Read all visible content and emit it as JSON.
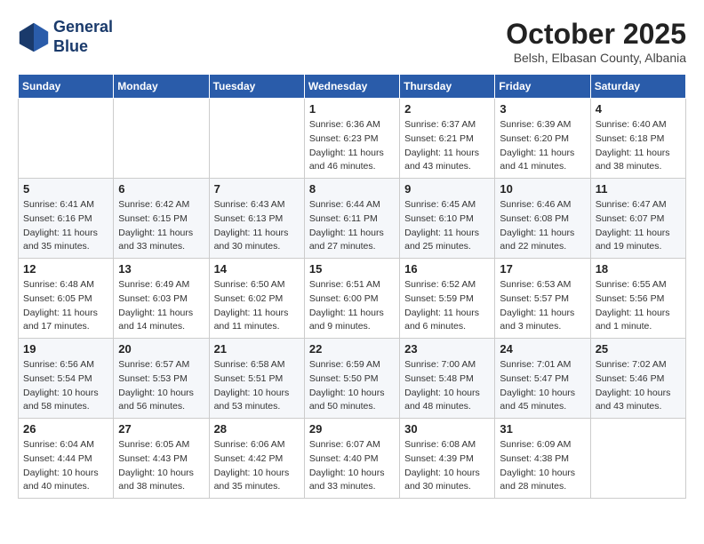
{
  "header": {
    "logo_line1": "General",
    "logo_line2": "Blue",
    "month": "October 2025",
    "location": "Belsh, Elbasan County, Albania"
  },
  "weekdays": [
    "Sunday",
    "Monday",
    "Tuesday",
    "Wednesday",
    "Thursday",
    "Friday",
    "Saturday"
  ],
  "weeks": [
    [
      {
        "day": "",
        "info": ""
      },
      {
        "day": "",
        "info": ""
      },
      {
        "day": "",
        "info": ""
      },
      {
        "day": "1",
        "info": "Sunrise: 6:36 AM\nSunset: 6:23 PM\nDaylight: 11 hours and 46 minutes."
      },
      {
        "day": "2",
        "info": "Sunrise: 6:37 AM\nSunset: 6:21 PM\nDaylight: 11 hours and 43 minutes."
      },
      {
        "day": "3",
        "info": "Sunrise: 6:39 AM\nSunset: 6:20 PM\nDaylight: 11 hours and 41 minutes."
      },
      {
        "day": "4",
        "info": "Sunrise: 6:40 AM\nSunset: 6:18 PM\nDaylight: 11 hours and 38 minutes."
      }
    ],
    [
      {
        "day": "5",
        "info": "Sunrise: 6:41 AM\nSunset: 6:16 PM\nDaylight: 11 hours and 35 minutes."
      },
      {
        "day": "6",
        "info": "Sunrise: 6:42 AM\nSunset: 6:15 PM\nDaylight: 11 hours and 33 minutes."
      },
      {
        "day": "7",
        "info": "Sunrise: 6:43 AM\nSunset: 6:13 PM\nDaylight: 11 hours and 30 minutes."
      },
      {
        "day": "8",
        "info": "Sunrise: 6:44 AM\nSunset: 6:11 PM\nDaylight: 11 hours and 27 minutes."
      },
      {
        "day": "9",
        "info": "Sunrise: 6:45 AM\nSunset: 6:10 PM\nDaylight: 11 hours and 25 minutes."
      },
      {
        "day": "10",
        "info": "Sunrise: 6:46 AM\nSunset: 6:08 PM\nDaylight: 11 hours and 22 minutes."
      },
      {
        "day": "11",
        "info": "Sunrise: 6:47 AM\nSunset: 6:07 PM\nDaylight: 11 hours and 19 minutes."
      }
    ],
    [
      {
        "day": "12",
        "info": "Sunrise: 6:48 AM\nSunset: 6:05 PM\nDaylight: 11 hours and 17 minutes."
      },
      {
        "day": "13",
        "info": "Sunrise: 6:49 AM\nSunset: 6:03 PM\nDaylight: 11 hours and 14 minutes."
      },
      {
        "day": "14",
        "info": "Sunrise: 6:50 AM\nSunset: 6:02 PM\nDaylight: 11 hours and 11 minutes."
      },
      {
        "day": "15",
        "info": "Sunrise: 6:51 AM\nSunset: 6:00 PM\nDaylight: 11 hours and 9 minutes."
      },
      {
        "day": "16",
        "info": "Sunrise: 6:52 AM\nSunset: 5:59 PM\nDaylight: 11 hours and 6 minutes."
      },
      {
        "day": "17",
        "info": "Sunrise: 6:53 AM\nSunset: 5:57 PM\nDaylight: 11 hours and 3 minutes."
      },
      {
        "day": "18",
        "info": "Sunrise: 6:55 AM\nSunset: 5:56 PM\nDaylight: 11 hours and 1 minute."
      }
    ],
    [
      {
        "day": "19",
        "info": "Sunrise: 6:56 AM\nSunset: 5:54 PM\nDaylight: 10 hours and 58 minutes."
      },
      {
        "day": "20",
        "info": "Sunrise: 6:57 AM\nSunset: 5:53 PM\nDaylight: 10 hours and 56 minutes."
      },
      {
        "day": "21",
        "info": "Sunrise: 6:58 AM\nSunset: 5:51 PM\nDaylight: 10 hours and 53 minutes."
      },
      {
        "day": "22",
        "info": "Sunrise: 6:59 AM\nSunset: 5:50 PM\nDaylight: 10 hours and 50 minutes."
      },
      {
        "day": "23",
        "info": "Sunrise: 7:00 AM\nSunset: 5:48 PM\nDaylight: 10 hours and 48 minutes."
      },
      {
        "day": "24",
        "info": "Sunrise: 7:01 AM\nSunset: 5:47 PM\nDaylight: 10 hours and 45 minutes."
      },
      {
        "day": "25",
        "info": "Sunrise: 7:02 AM\nSunset: 5:46 PM\nDaylight: 10 hours and 43 minutes."
      }
    ],
    [
      {
        "day": "26",
        "info": "Sunrise: 6:04 AM\nSunset: 4:44 PM\nDaylight: 10 hours and 40 minutes."
      },
      {
        "day": "27",
        "info": "Sunrise: 6:05 AM\nSunset: 4:43 PM\nDaylight: 10 hours and 38 minutes."
      },
      {
        "day": "28",
        "info": "Sunrise: 6:06 AM\nSunset: 4:42 PM\nDaylight: 10 hours and 35 minutes."
      },
      {
        "day": "29",
        "info": "Sunrise: 6:07 AM\nSunset: 4:40 PM\nDaylight: 10 hours and 33 minutes."
      },
      {
        "day": "30",
        "info": "Sunrise: 6:08 AM\nSunset: 4:39 PM\nDaylight: 10 hours and 30 minutes."
      },
      {
        "day": "31",
        "info": "Sunrise: 6:09 AM\nSunset: 4:38 PM\nDaylight: 10 hours and 28 minutes."
      },
      {
        "day": "",
        "info": ""
      }
    ]
  ]
}
